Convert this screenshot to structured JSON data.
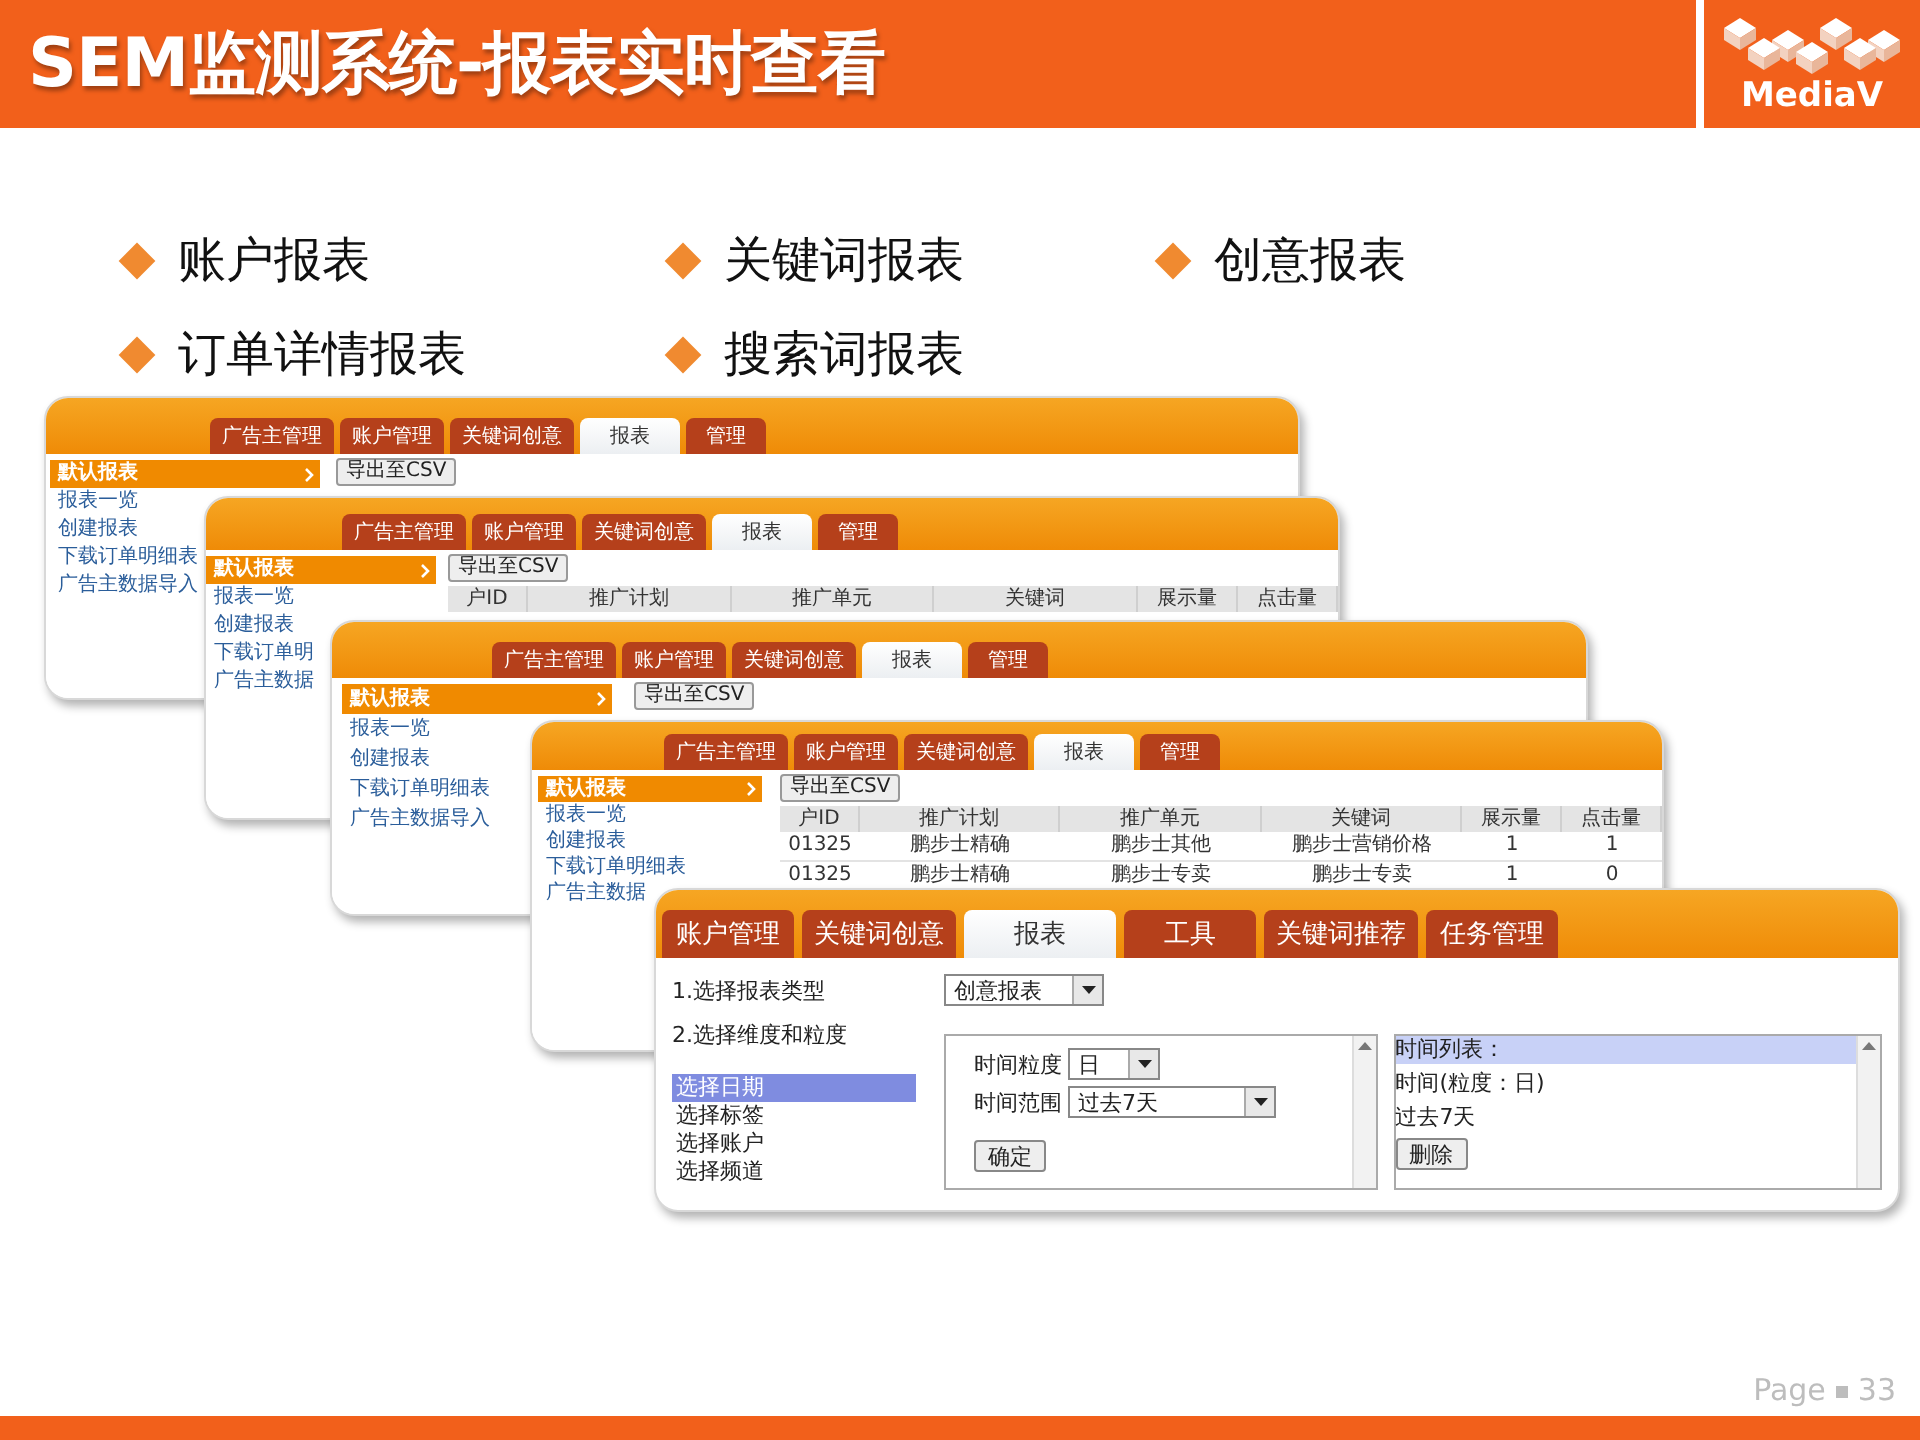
{
  "slide": {
    "title": "SEM监测系统-报表实时查看",
    "logo": "MediaV",
    "page_label": "Page",
    "page_number": "33"
  },
  "bullets": [
    "账户报表",
    "关键词报表",
    "创意报表",
    "订单详情报表",
    "搜索词报表"
  ],
  "screenshots": [
    {
      "kind": "report-list",
      "tabs": [
        {
          "label": "广告主管理",
          "selected": false
        },
        {
          "label": "账户管理",
          "selected": false
        },
        {
          "label": "关键词创意",
          "selected": false
        },
        {
          "label": "报表",
          "selected": true
        },
        {
          "label": "管理",
          "selected": false
        }
      ],
      "sidebar": [
        {
          "label": "默认报表",
          "selected": true
        },
        {
          "label": "报表一览",
          "selected": false
        },
        {
          "label": "创建报表",
          "selected": false
        },
        {
          "label": "下载订单明细表",
          "selected": false
        },
        {
          "label": "广告主数据导入",
          "selected": false
        }
      ],
      "export_button": "导出至CSV"
    },
    {
      "kind": "report-list",
      "tabs": [
        {
          "label": "广告主管理",
          "selected": false
        },
        {
          "label": "账户管理",
          "selected": false
        },
        {
          "label": "关键词创意",
          "selected": false
        },
        {
          "label": "报表",
          "selected": true
        },
        {
          "label": "管理",
          "selected": false
        }
      ],
      "sidebar": [
        {
          "label": "默认报表",
          "selected": true
        },
        {
          "label": "报表一览",
          "selected": false
        },
        {
          "label": "创建报表",
          "selected": false
        },
        {
          "label": "下载订单明",
          "selected": false
        },
        {
          "label": "广告主数据",
          "selected": false
        }
      ],
      "export_button": "导出至CSV",
      "table": {
        "columns": [
          "户ID",
          "推广计划",
          "推广单元",
          "关键词",
          "展示量",
          "点击量"
        ]
      }
    },
    {
      "kind": "report-list",
      "tabs": [
        {
          "label": "广告主管理",
          "selected": false
        },
        {
          "label": "账户管理",
          "selected": false
        },
        {
          "label": "关键词创意",
          "selected": false
        },
        {
          "label": "报表",
          "selected": true
        },
        {
          "label": "管理",
          "selected": false
        }
      ],
      "sidebar": [
        {
          "label": "默认报表",
          "selected": true
        },
        {
          "label": "报表一览",
          "selected": false
        },
        {
          "label": "创建报表",
          "selected": false
        },
        {
          "label": "下载订单明细表",
          "selected": false
        },
        {
          "label": "广告主数据导入",
          "selected": false
        }
      ],
      "export_button": "导出至CSV"
    },
    {
      "kind": "report-list",
      "tabs": [
        {
          "label": "广告主管理",
          "selected": false
        },
        {
          "label": "账户管理",
          "selected": false
        },
        {
          "label": "关键词创意",
          "selected": false
        },
        {
          "label": "报表",
          "selected": true
        },
        {
          "label": "管理",
          "selected": false
        }
      ],
      "sidebar": [
        {
          "label": "默认报表",
          "selected": true
        },
        {
          "label": "报表一览",
          "selected": false
        },
        {
          "label": "创建报表",
          "selected": false
        },
        {
          "label": "下载订单明细表",
          "selected": false
        },
        {
          "label": "广告主数据",
          "selected": false
        }
      ],
      "export_button": "导出至CSV",
      "table": {
        "columns": [
          "户ID",
          "推广计划",
          "推广单元",
          "关键词",
          "展示量",
          "点击量"
        ],
        "rows": [
          [
            "01325",
            "鹏步士精确",
            "鹏步士其他",
            "鹏步士营销价格",
            "1",
            "1"
          ],
          [
            "01325",
            "鹏步士精确",
            "鹏步士专卖",
            "鹏步士专卖",
            "1",
            "0"
          ]
        ]
      }
    },
    {
      "kind": "report-builder",
      "tabs": [
        {
          "label": "账户管理",
          "selected": false
        },
        {
          "label": "关键词创意",
          "selected": false
        },
        {
          "label": "报表",
          "selected": true
        },
        {
          "label": "工具",
          "selected": false
        },
        {
          "label": "关键词推荐",
          "selected": false
        },
        {
          "label": "任务管理",
          "selected": false
        }
      ],
      "steps": [
        "1.选择报表类型",
        "2.选择维度和粒度"
      ],
      "report_type": "创意报表",
      "menu": [
        {
          "label": "选择日期",
          "selected": true
        },
        {
          "label": "选择标签",
          "selected": false
        },
        {
          "label": "选择账户",
          "selected": false
        },
        {
          "label": "选择频道",
          "selected": false
        }
      ],
      "granularity_label": "时间粒度",
      "granularity": "日",
      "range_label": "时间范围",
      "range": "过去7天",
      "confirm_button": "确定",
      "list_title": "时间列表：",
      "list_items": [
        "时间(粒度：日)",
        "过去7天"
      ],
      "delete_button": "删除"
    }
  ]
}
